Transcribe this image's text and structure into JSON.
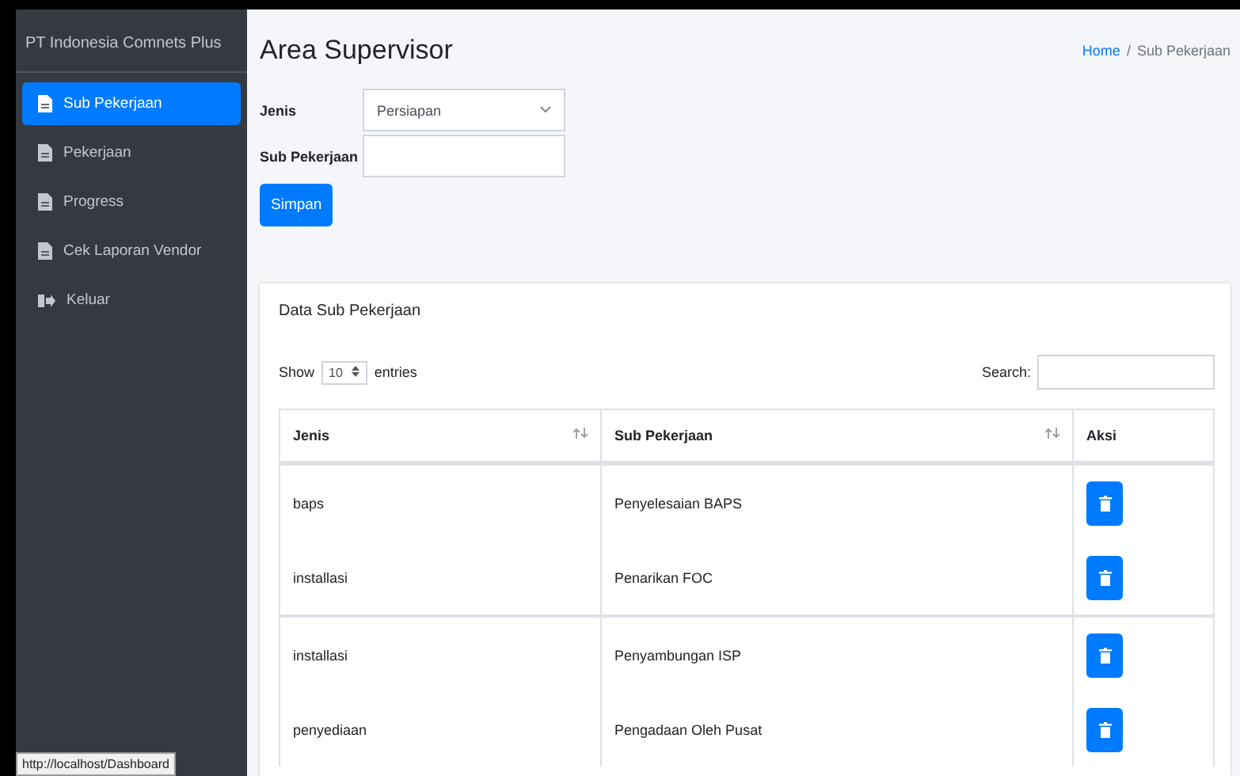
{
  "sidebar": {
    "brand": "PT Indonesia Comnets Plus",
    "items": [
      {
        "label": "Sub Pekerjaan",
        "kind": "page",
        "selected": true
      },
      {
        "label": "Pekerjaan",
        "kind": "page",
        "selected": false
      },
      {
        "label": "Progress",
        "kind": "page",
        "selected": false
      },
      {
        "label": "Cek Laporan Vendor",
        "kind": "page",
        "selected": false
      },
      {
        "label": "Keluar",
        "kind": "exit",
        "selected": false
      }
    ]
  },
  "header": {
    "title": "Area Supervisor",
    "breadcrumb": [
      {
        "label": "Home",
        "link": true
      },
      {
        "label": "Sub Pekerjaan",
        "link": false
      }
    ],
    "separator": "/"
  },
  "form": {
    "fields": [
      {
        "label": "Jenis",
        "kind": "select",
        "value": "Persiapan"
      },
      {
        "label": "Sub Pekerjaan",
        "kind": "text"
      }
    ],
    "submit": "Simpan"
  },
  "card": {
    "title": "Data Sub Pekerjaan",
    "length": {
      "before": "Show",
      "value": "10",
      "after": "entries"
    },
    "search_label": "Search:",
    "table": {
      "columns": [
        {
          "label": "Jenis",
          "sortable": true
        },
        {
          "label": "Sub Pekerjaan",
          "sortable": true
        },
        {
          "label": "Aksi",
          "sortable": false
        }
      ],
      "rows": [
        [
          "baps",
          "Penyelesaian BAPS"
        ],
        [
          "installasi",
          "Penarikan FOC"
        ],
        [
          "installasi",
          "Penyambungan ISP"
        ],
        [
          "penyediaan",
          "Pengadaan Oleh Pusat"
        ]
      ]
    }
  },
  "status_bar": {
    "url": "http://localhost/Dashboard"
  }
}
